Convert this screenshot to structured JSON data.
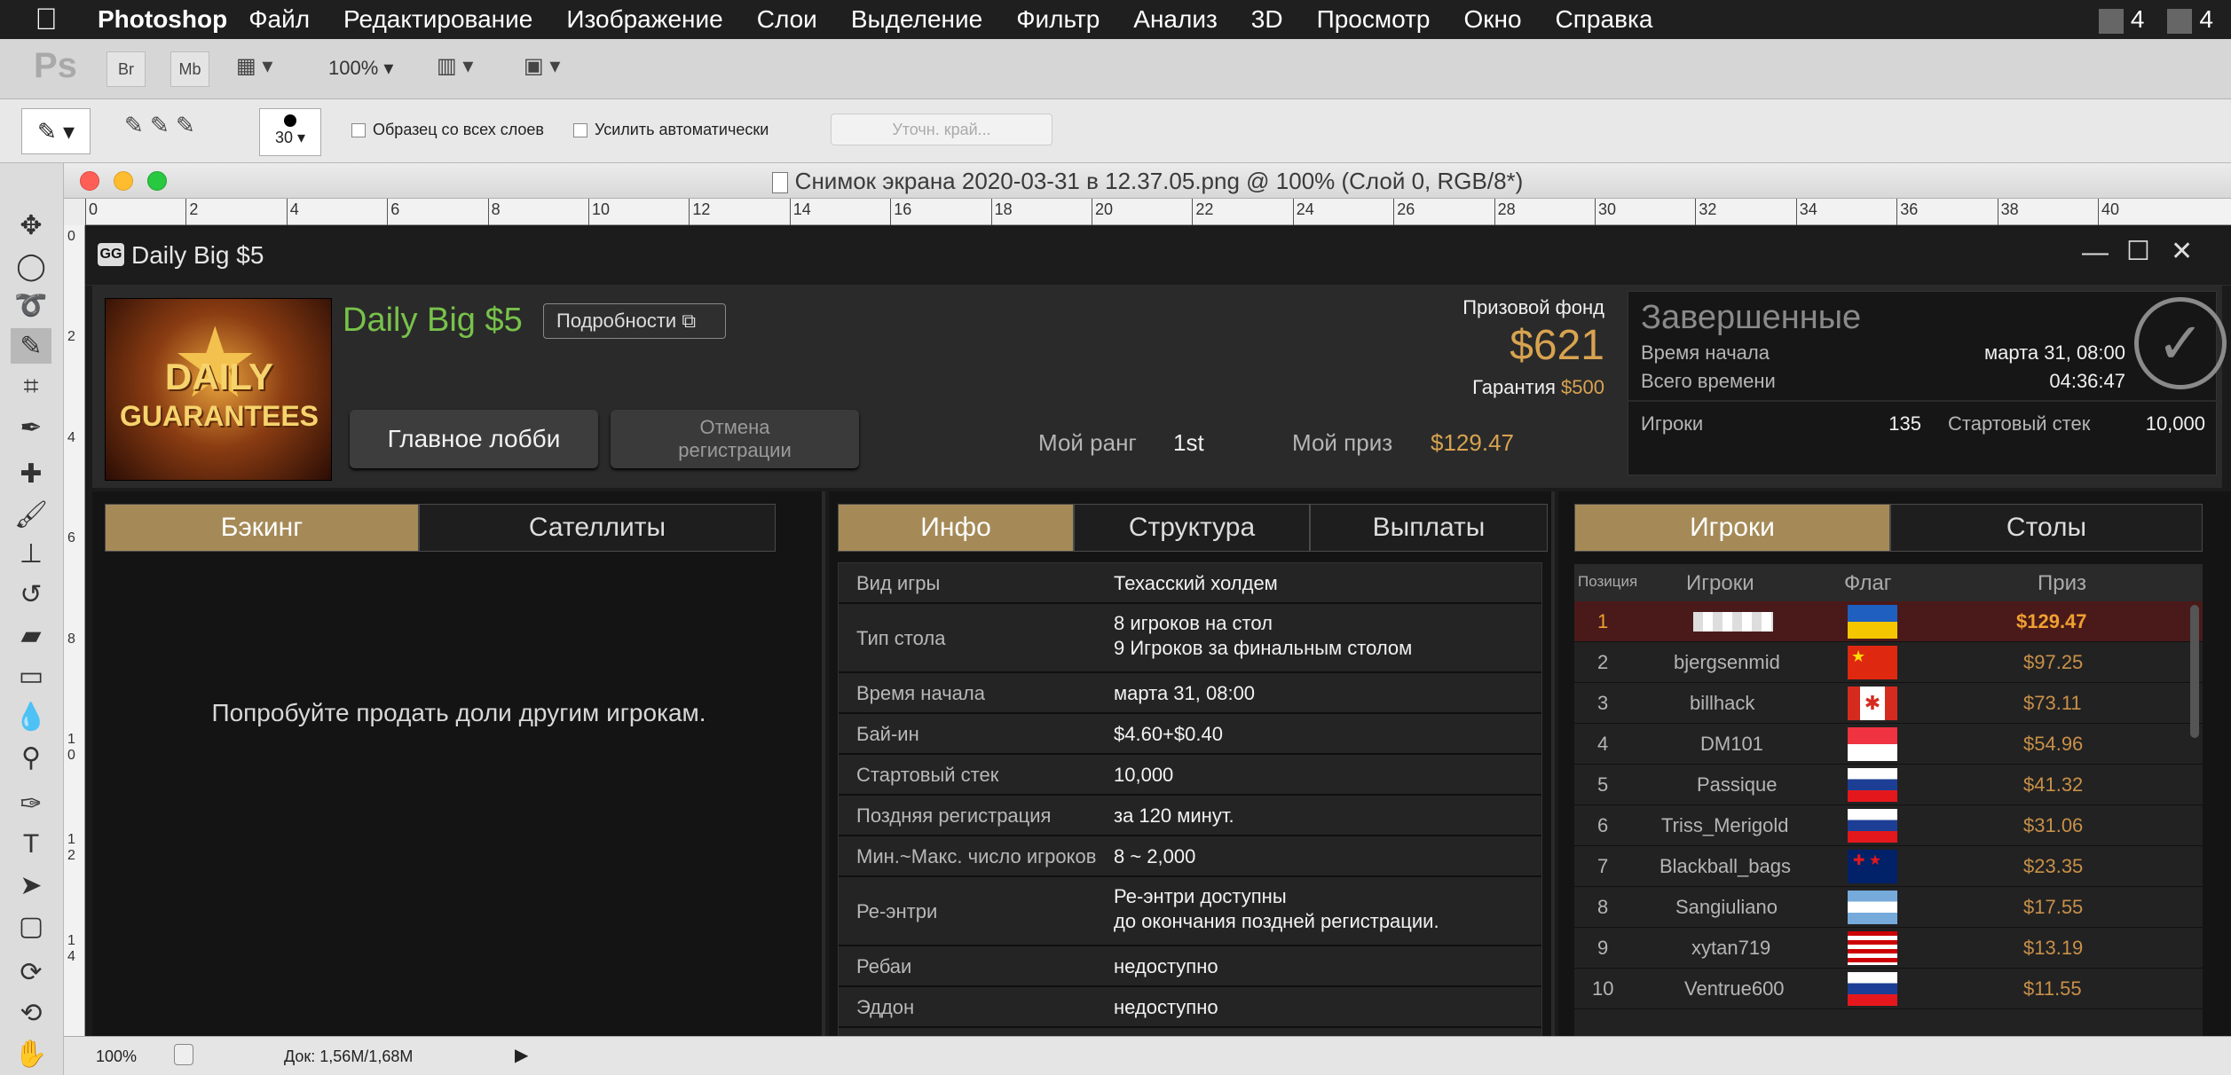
{
  "menubar": {
    "app": "Photoshop",
    "items": [
      "Файл",
      "Редактирование",
      "Изображение",
      "Слои",
      "Выделение",
      "Фильтр",
      "Анализ",
      "3D",
      "Просмотр",
      "Окно",
      "Справка"
    ],
    "right": [
      "4",
      "4"
    ]
  },
  "appbar": {
    "logo": "Ps",
    "br": "Br",
    "mb": "Mb",
    "zoom": "100%"
  },
  "options": {
    "brush_size": "30",
    "sample_all": "Образец со всех слоев",
    "auto_enhance": "Усилить автоматически",
    "refine_edge": "Уточн. край..."
  },
  "document": {
    "title": "Снимок экрана 2020-03-31 в 12.37.05.png @ 100% (Слой 0, RGB/8*)",
    "ruler_h": [
      "0",
      "2",
      "4",
      "6",
      "8",
      "10",
      "12",
      "14",
      "16",
      "18",
      "20",
      "22",
      "24",
      "26",
      "28",
      "30",
      "32",
      "34",
      "36",
      "38",
      "40"
    ],
    "ruler_v": [
      "0",
      "2",
      "4",
      "6",
      "8",
      "1\n0",
      "1\n2",
      "1\n4"
    ],
    "status_zoom": "100%",
    "status_doc": "Док: 1,56M/1,68M"
  },
  "client": {
    "window_title": "Daily Big $5",
    "logo_text": [
      "DAILY",
      "GUARANTEES"
    ],
    "tournament_name": "Daily Big $5",
    "details_btn": "Подробности",
    "main_lobby_btn": "Главное лобби",
    "cancel_reg_btn": "Отмена\nрегистрации",
    "prize_pool_label": "Призовой фонд",
    "prize_pool": "$621",
    "guarantee_label": "Гарантия",
    "guarantee": "$500",
    "my_rank_label": "Мой ранг",
    "my_rank": "1st",
    "my_prize_label": "Мой приз",
    "my_prize": "$129.47",
    "status": "Завершенные",
    "start_time_label": "Время начала",
    "start_time": "марта 31, 08:00",
    "total_time_label": "Всего времени",
    "total_time": "04:36:47",
    "players_label": "Игроки",
    "players": "135",
    "start_stack_label": "Стартовый стек",
    "start_stack": "10,000",
    "left_tabs": [
      "Бэкинг",
      "Сателлиты"
    ],
    "backing_msg": "Попробуйте продать доли другим игрокам.",
    "mid_tabs": [
      "Инфо",
      "Структура",
      "Выплаты"
    ],
    "info_rows": [
      {
        "k": "Вид игры",
        "v": "Техасский холдем"
      },
      {
        "k": "Тип стола",
        "v": "8 игроков на стол\n9 Игроков за финальным столом"
      },
      {
        "k": "Время начала",
        "v": "марта 31, 08:00"
      },
      {
        "k": "Бай-ин",
        "v": "$4.60+$0.40"
      },
      {
        "k": "Стартовый стек",
        "v": "10,000"
      },
      {
        "k": "Поздняя регистрация",
        "v": "за 120 минут."
      },
      {
        "k": "Мин.~Макс. число игроков",
        "v": "8 ~ 2,000"
      },
      {
        "k": "Ре-энтри",
        "v": "Ре-энтри доступны\nдо окончания поздней регистрации."
      },
      {
        "k": "Ребаи",
        "v": "недоступно"
      },
      {
        "k": "Эддон",
        "v": "недоступно"
      }
    ],
    "right_tabs": [
      "Игроки",
      "Столы"
    ],
    "players_cols": [
      "Позиция",
      "Игроки",
      "Флаг",
      "Приз"
    ],
    "players_rows": [
      {
        "pos": "1",
        "name": "",
        "prize": "$129.47",
        "flag": "ua"
      },
      {
        "pos": "2",
        "name": "bjergsenmid",
        "prize": "$97.25",
        "flag": "cn"
      },
      {
        "pos": "3",
        "name": "billhack",
        "prize": "$73.11",
        "flag": "ca"
      },
      {
        "pos": "4",
        "name": "DM101",
        "prize": "$54.96",
        "flag": "sg"
      },
      {
        "pos": "5",
        "name": "Passique",
        "prize": "$41.32",
        "flag": "ru"
      },
      {
        "pos": "6",
        "name": "Triss_Merigold",
        "prize": "$31.06",
        "flag": "ru"
      },
      {
        "pos": "7",
        "name": "Blackball_bags",
        "prize": "$23.35",
        "flag": "nz"
      },
      {
        "pos": "8",
        "name": "Sangiuliano",
        "prize": "$17.55",
        "flag": "ar"
      },
      {
        "pos": "9",
        "name": "xytan719",
        "prize": "$13.19",
        "flag": "my"
      },
      {
        "pos": "10",
        "name": "Ventrue600",
        "prize": "$11.55",
        "flag": "ru"
      }
    ]
  }
}
